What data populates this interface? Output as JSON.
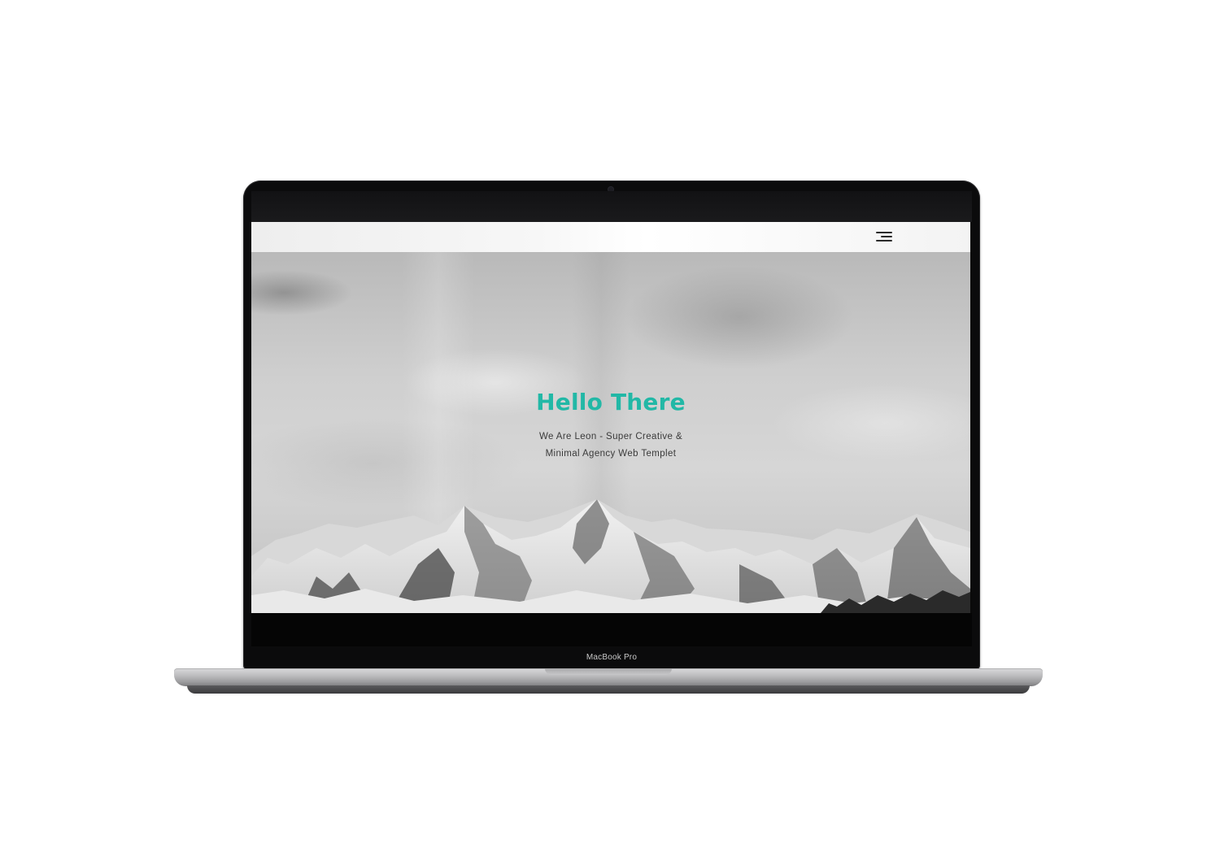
{
  "device": {
    "label": "MacBook Pro"
  },
  "site": {
    "menu_icon": "hamburger-menu-icon",
    "hero": {
      "title": "Hello There",
      "subtitle": "We Are Leon - Super Creative & Minimal Agency Web Templet"
    }
  },
  "colors": {
    "accent": "#22b8a6",
    "hero_text": "#3a3a3a",
    "bezel": "#0b0b0c"
  }
}
